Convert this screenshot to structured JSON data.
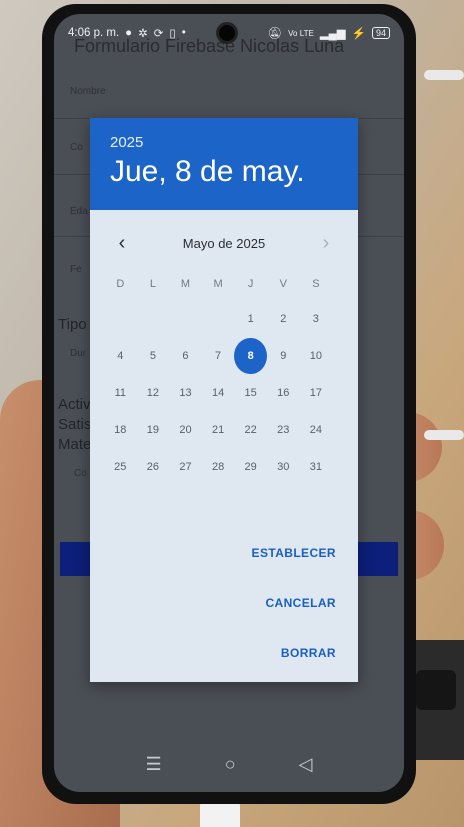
{
  "status": {
    "time": "4:06 p. m.",
    "icons": [
      "notification-icon",
      "settings-icon",
      "sync-icon",
      "clipboard-icon"
    ],
    "volte": "Vo LTE",
    "battery": "94"
  },
  "app": {
    "title": "Formulario Firebase Nicolas Luna",
    "fields": [
      "Nombre",
      "Co",
      "Eda",
      "Fe"
    ],
    "section_tipo": "Tipo",
    "tipo_option": "Dur",
    "section_activ": [
      "Activ",
      "Satis",
      "Mate"
    ],
    "link_text": "Co"
  },
  "dialog": {
    "year": "2025",
    "selected_date": "Jue, 8 de may.",
    "month_label": "Mayo de 2025",
    "weekdays": [
      "D",
      "L",
      "M",
      "M",
      "J",
      "V",
      "S"
    ],
    "leading_blanks": 4,
    "days_in_month": 31,
    "selected_day": 8,
    "buttons": {
      "set": "ESTABLECER",
      "cancel": "CANCELAR",
      "clear": "BORRAR"
    }
  },
  "colors": {
    "accent": "#1d64c9",
    "dialog_bg": "#dfe7f0"
  }
}
